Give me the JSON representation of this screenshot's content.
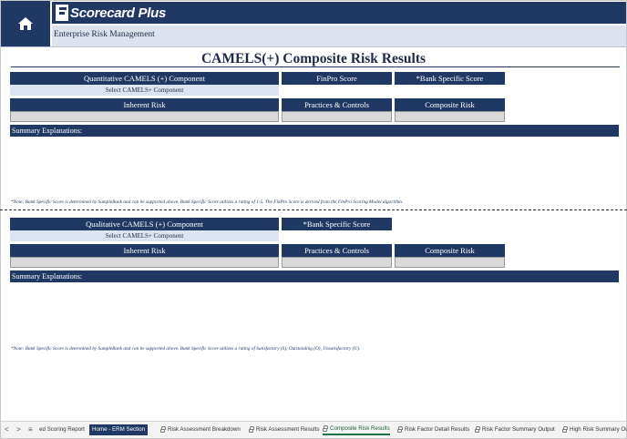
{
  "brand": {
    "name": "Scorecard Plus",
    "subtitle": "Enterprise Risk Management"
  },
  "page_title": "CAMELS(+) Composite Risk Results",
  "quantitative": {
    "component_header": "Quantitative CAMELS (+) Component",
    "component_select": "Select CAMELS+ Component",
    "finpro_header": "FinPro Score",
    "bank_score_header": "*Bank Specific Score",
    "inherent_risk_header": "Inherent Risk",
    "practices_header": "Practices & Controls",
    "composite_header": "Composite Risk",
    "summary_header": "Summary Explanations:",
    "note": "*Note: Bank Specific Score is determined by SampleBank and can be supported above.  Bank Specific Score utilizes a rating of 1-5. The FinPro Score is derived from the FinPro Scoring Model algorithm."
  },
  "qualitative": {
    "component_header": "Qualitative CAMELS (+) Component",
    "component_select": "Select CAMELS+ Component",
    "bank_score_header": "*Bank Specific Score",
    "inherent_risk_header": "Inherent Risk",
    "practices_header": "Practices & Controls",
    "composite_header": "Composite Risk",
    "summary_header": "Summary Explanations:",
    "note": "*Note: Bank Specific Score is determined by SampleBank and can be supported above.  Bank Specific Score utilizes a rating of Satisfactory (S), Outstanding (O), Unsatisfactory (U)."
  },
  "sheet_tabs": {
    "nav_prev": "<",
    "nav_next": ">",
    "nav_menu": "≡",
    "tabs": [
      "ed Scoring Report",
      "Home - ERM Section",
      "Risk Assessment Breakdown",
      "Risk Assessment Results",
      "Composite Risk Results",
      "Risk Factor Detail Results",
      "Risk Factor Summary Output",
      "High Risk Summary Ou"
    ],
    "active_tab": "Composite Risk Results"
  },
  "colors": {
    "navy": "#1f3864",
    "light_blue": "#dce4f2",
    "grey_cell": "#d9d9d9",
    "active_tab_underline": "#1e7145"
  },
  "icons": {
    "home": "home-icon",
    "brand": "scorecard-logo-icon",
    "lock": "lock-icon"
  }
}
